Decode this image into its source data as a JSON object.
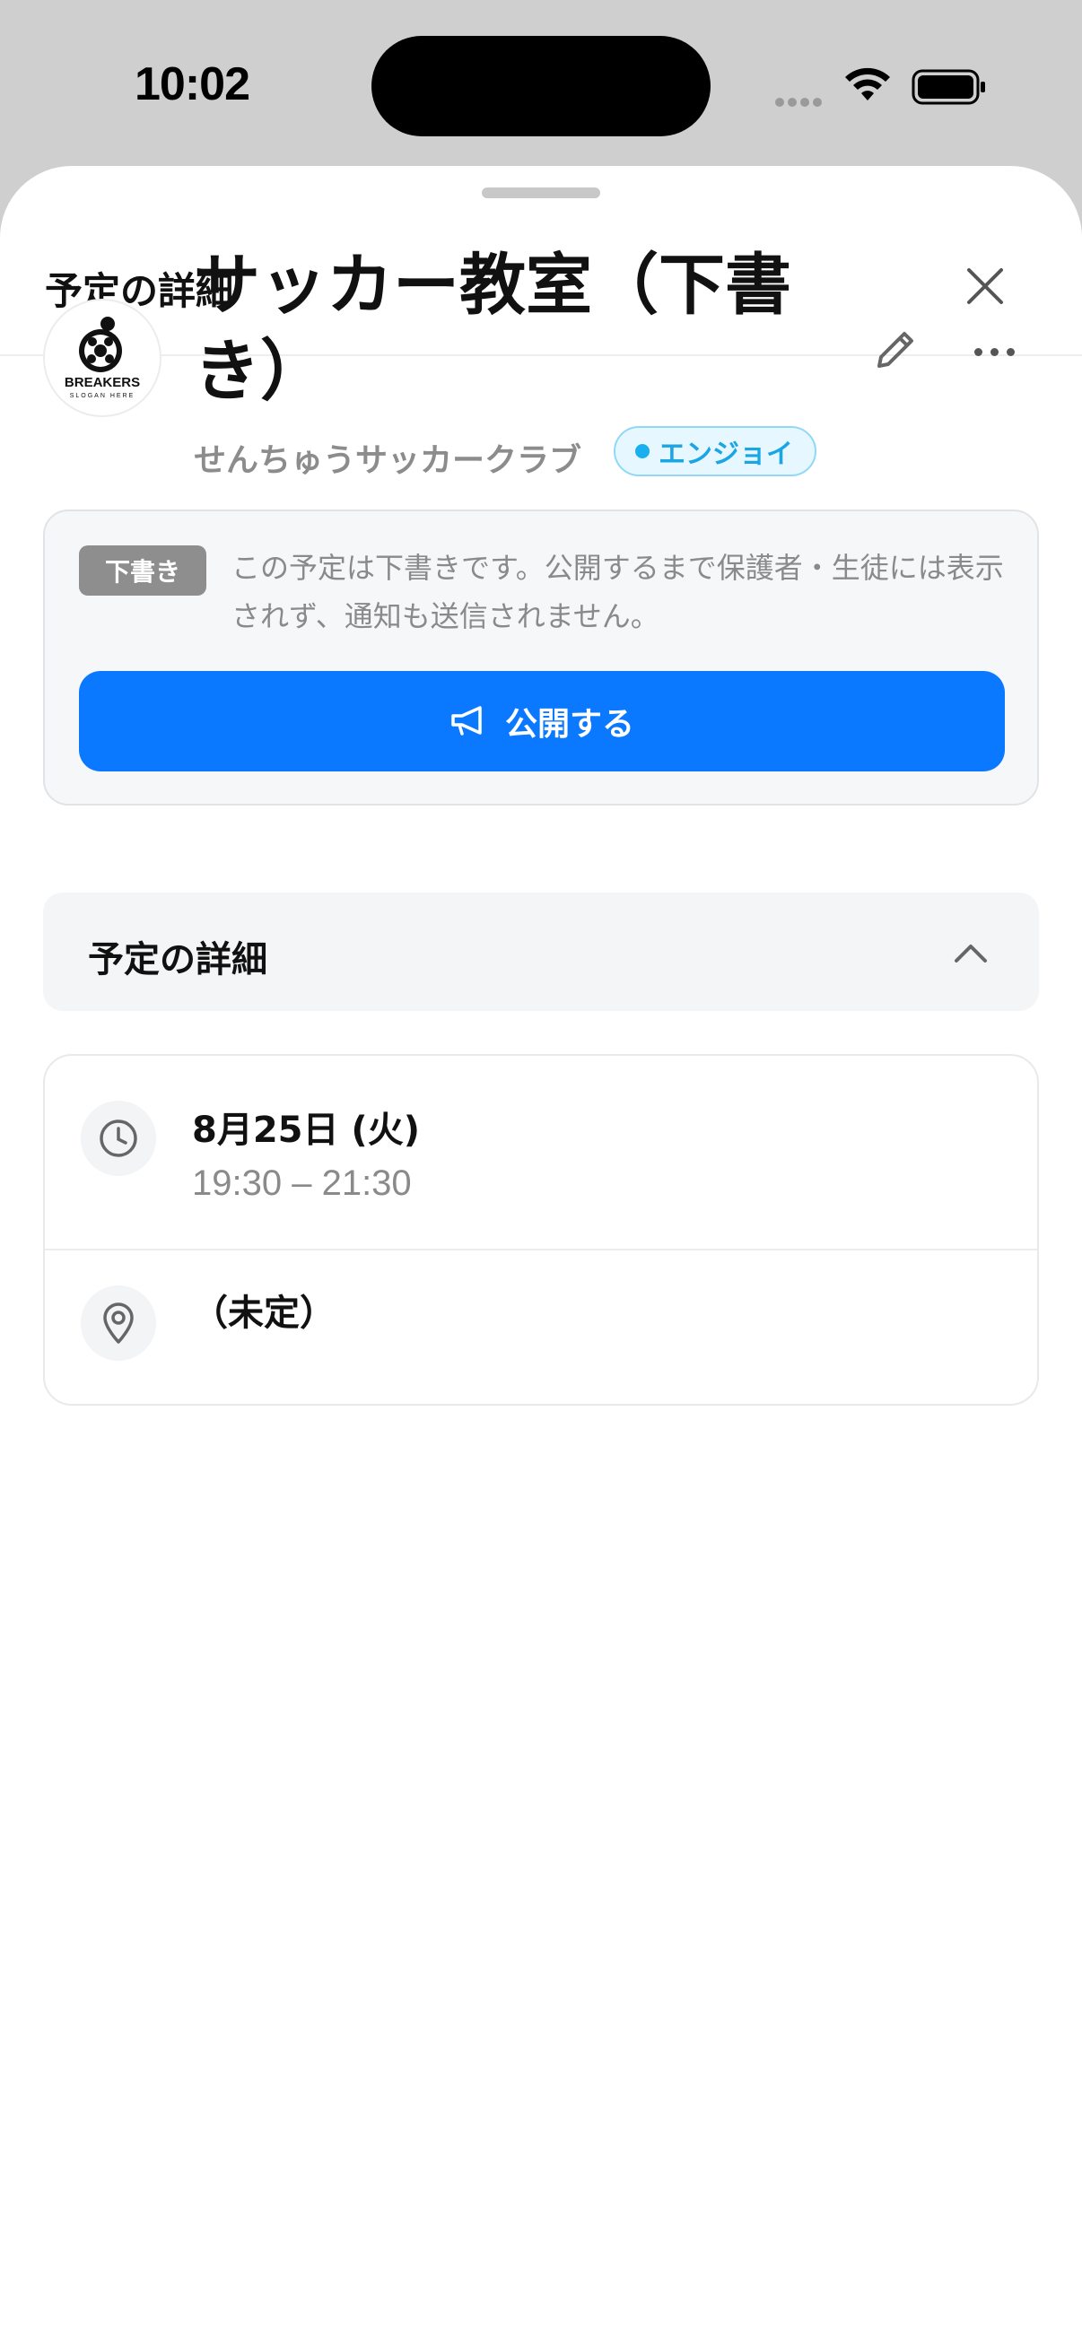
{
  "status_bar": {
    "time": "10:02"
  },
  "sheet": {
    "title": "予定の詳細"
  },
  "event": {
    "title": "サッカー教室（下書き）",
    "club_name": "せんちゅうサッカークラブ",
    "level_badge": "エンジョイ",
    "logo_text": "BREAKERS",
    "logo_subtext": "SLOGAN HERE"
  },
  "draft": {
    "tag": "下書き",
    "message": "この予定は下書きです。公開するまで保護者・生徒には表示されず、通知も送信されません。",
    "publish_label": "公開する"
  },
  "details": {
    "section_title": "予定の詳細",
    "date": "8月25日 (火)",
    "time_range": "19:30 – 21:30",
    "place": "（未定）"
  },
  "colors": {
    "primary": "#0a78ff",
    "badge_bg": "#e6f7ff",
    "badge_text": "#1aa6e4",
    "draft_tag": "#8e8e8e"
  },
  "icons": [
    "close-icon",
    "pencil-icon",
    "more-icon",
    "megaphone-icon",
    "chevron-up-icon",
    "clock-icon",
    "map-pin-icon",
    "wifi-icon",
    "battery-icon"
  ]
}
